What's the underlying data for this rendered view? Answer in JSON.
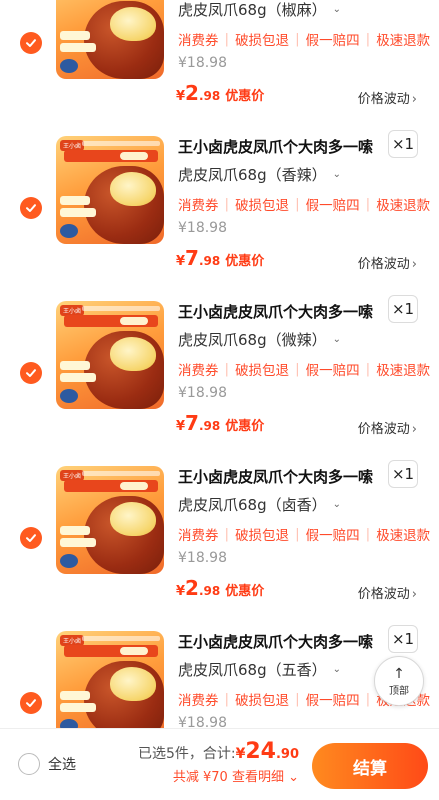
{
  "items": [
    {
      "title": "",
      "spec": "虎皮凤爪68g（椒麻）",
      "qty": "",
      "tags": [
        "消费券",
        "破损包退",
        "假一赔四",
        "极速退款"
      ],
      "original_price": "¥18.98",
      "price_yen": "¥",
      "price_int": "2",
      "price_dec": ".98",
      "price_label": "优惠价",
      "wave_label": "价格波动",
      "selected": true
    },
    {
      "title": "王小卤虎皮凤爪个大肉多一嗦",
      "spec": "虎皮凤爪68g（香辣）",
      "qty": "×1",
      "tags": [
        "消费券",
        "破损包退",
        "假一赔四",
        "极速退款"
      ],
      "original_price": "¥18.98",
      "price_yen": "¥",
      "price_int": "7",
      "price_dec": ".98",
      "price_label": "优惠价",
      "wave_label": "价格波动",
      "selected": true
    },
    {
      "title": "王小卤虎皮凤爪个大肉多一嗦",
      "spec": "虎皮凤爪68g（微辣）",
      "qty": "×1",
      "tags": [
        "消费券",
        "破损包退",
        "假一赔四",
        "极速退款"
      ],
      "original_price": "¥18.98",
      "price_yen": "¥",
      "price_int": "7",
      "price_dec": ".98",
      "price_label": "优惠价",
      "wave_label": "价格波动",
      "selected": true
    },
    {
      "title": "王小卤虎皮凤爪个大肉多一嗦",
      "spec": "虎皮凤爪68g（卤香）",
      "qty": "×1",
      "tags": [
        "消费券",
        "破损包退",
        "假一赔四",
        "极速退款"
      ],
      "original_price": "¥18.98",
      "price_yen": "¥",
      "price_int": "2",
      "price_dec": ".98",
      "price_label": "优惠价",
      "wave_label": "价格波动",
      "selected": true
    },
    {
      "title": "王小卤虎皮凤爪个大肉多一嗦",
      "spec": "虎皮凤爪68g（五香）",
      "qty": "×1",
      "tags": [
        "消费券",
        "破损包退",
        "假一赔四",
        "极速退款"
      ],
      "original_price": "¥18.98",
      "price_yen": "",
      "price_int": "",
      "price_dec": "",
      "price_label": "",
      "wave_label": "",
      "selected": true
    }
  ],
  "to_top": {
    "icon": "arrow-up-icon",
    "label": "顶部"
  },
  "footer": {
    "select_all_label": "全选",
    "selected_count_text": "已选5件，",
    "total_label": "合计:",
    "total_yen": "¥",
    "total_int": "24",
    "total_dec": ".90",
    "discount_text": "共减 ¥70",
    "detail_text": "查看明细",
    "detail_arrow": "⌄",
    "checkout_label": "结算"
  },
  "colors": {
    "accent": "#ff5a1f",
    "price_red": "#ff3b14",
    "tag_red": "#ff4b2b"
  }
}
